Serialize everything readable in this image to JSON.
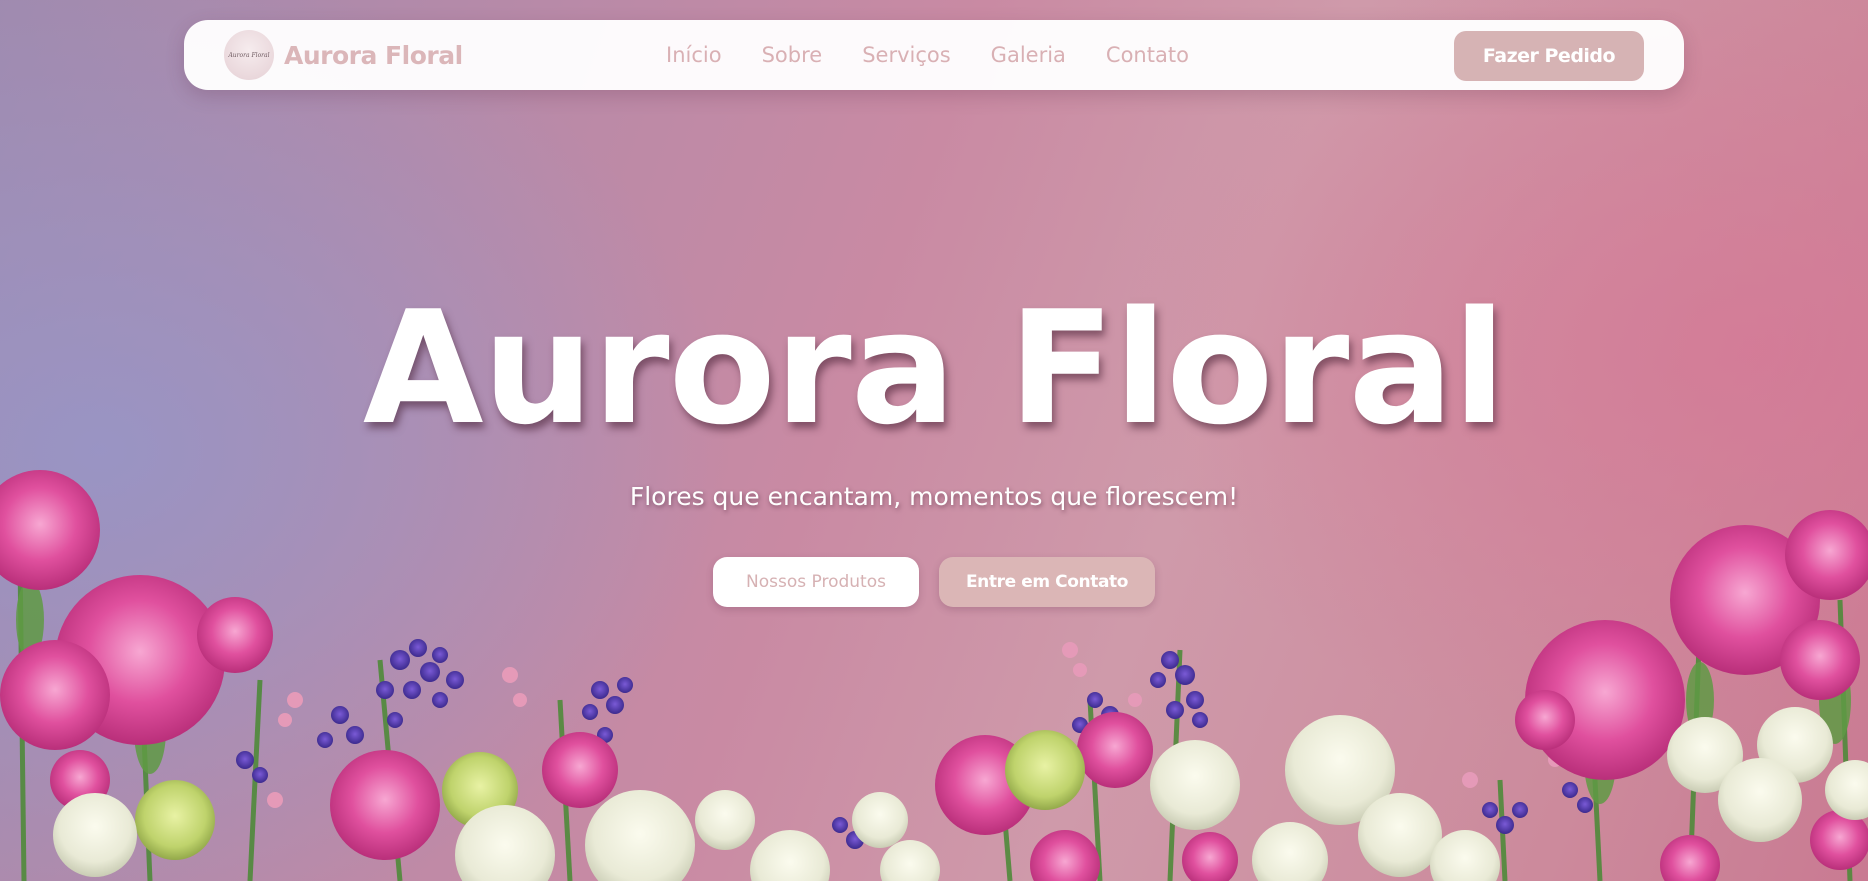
{
  "brand": {
    "name": "Aurora Floral",
    "logo_text": "Aurora Floral"
  },
  "nav": {
    "links": [
      "Início",
      "Sobre",
      "Serviços",
      "Galeria",
      "Contato"
    ],
    "cta_label": "Fazer Pedido"
  },
  "hero": {
    "title": "Aurora Floral",
    "subtitle": "Flores que encantam, momentos que florescem!",
    "primary_button": "Nossos Produtos",
    "secondary_button": "Entre em Contato"
  },
  "colors": {
    "accent": "#d6b3b4",
    "nav_text": "#d9b0b4",
    "background_left": "#a08aae",
    "background_right": "#c97a92"
  }
}
